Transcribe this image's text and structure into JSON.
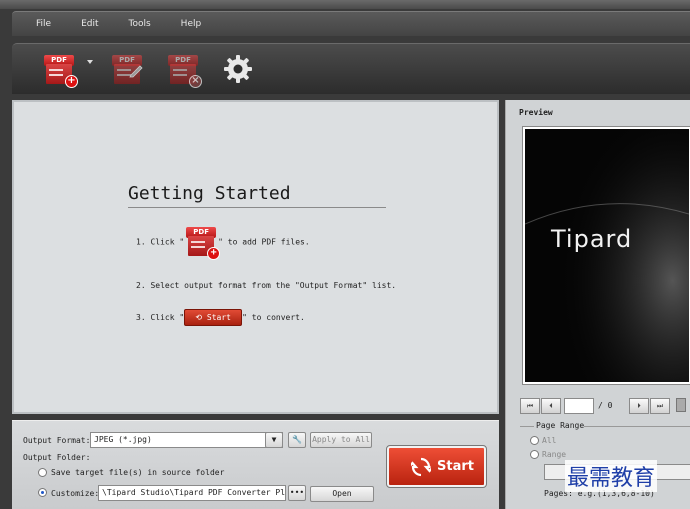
{
  "menu": {
    "file": "File",
    "edit": "Edit",
    "tools": "Tools",
    "help": "Help"
  },
  "toolbar": {
    "pdf_tag": "PDF",
    "add_badge": "+",
    "remove_badge": "×"
  },
  "getting_started": {
    "title": "Getting Started",
    "step1_before": "1. Click \"",
    "step1_after": "\" to add PDF files.",
    "step2": "2. Select output format from the \"Output Format\" list.",
    "step3_before": "3. Click \"",
    "step3_button": "Start",
    "step3_after": "\" to convert."
  },
  "settings": {
    "output_format_label": "Output Format:",
    "output_format_value": "JPEG (*.jpg)",
    "apply_to_all": "Apply to All",
    "output_folder_label": "Output Folder:",
    "option_source": "Save target file(s) in source folder",
    "option_customize": "Customize:",
    "customize_path": "\\Tipard Studio\\Tipard PDF Converter Plati",
    "browse": "•••",
    "open": "Open"
  },
  "start_button": "Start",
  "preview": {
    "label": "Preview",
    "logo_text": "Tipard",
    "page_total": "/ 0",
    "page_range_label": "Page Range",
    "option_all": "All",
    "option_range": "Range",
    "pages_hint": "Pages: e.g.(1,3,6,8-10)"
  },
  "watermark": "最需教育",
  "colors": {
    "accent_red": "#c8321c",
    "panel_bg": "#dcdfe1",
    "toolbar_dark": "#3a3a3a"
  },
  "icons": [
    "add-pdf-icon",
    "edit-pdf-icon",
    "remove-pdf-icon",
    "settings-gear-icon",
    "refresh-arrows-icon"
  ]
}
